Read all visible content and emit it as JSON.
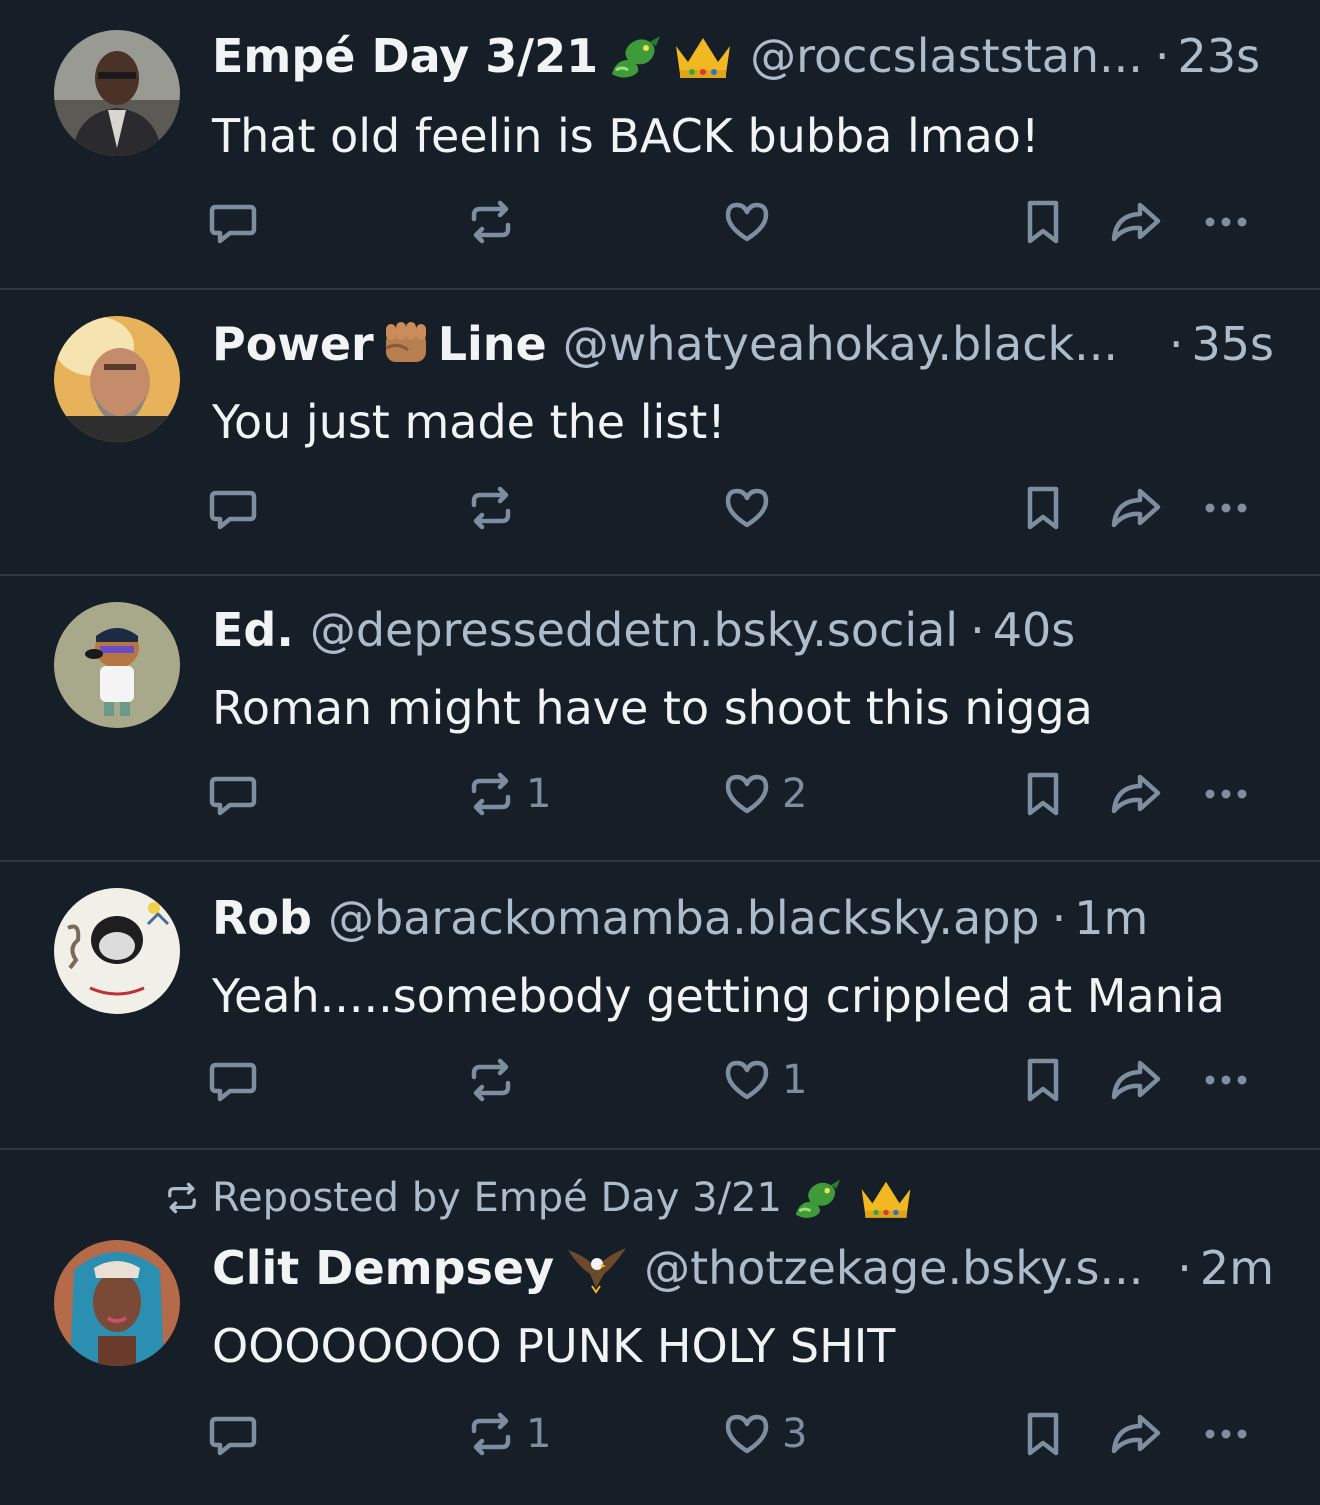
{
  "feed": {
    "posts": [
      {
        "name": "Empé Day 3/21",
        "emoji": [
          "dragon-emoji",
          "crown-emoji"
        ],
        "handle": "@roccslaststan...",
        "time": "23s",
        "text": "That old feelin is BACK bubba lmao!",
        "reply_count": "",
        "repost_count": "",
        "like_count": ""
      },
      {
        "name": "Power",
        "name_suffix": "Line",
        "emoji": [
          "raised-fist-emoji"
        ],
        "handle": "@whatyeahokay.black...",
        "time": "35s",
        "text": "You just made the list!",
        "reply_count": "",
        "repost_count": "",
        "like_count": ""
      },
      {
        "name": "Ed.",
        "handle": "@depresseddetn.bsky.social",
        "time": "40s",
        "text": "Roman might have to shoot this nigga",
        "reply_count": "",
        "repost_count": "1",
        "like_count": "2"
      },
      {
        "name": "Rob",
        "handle": "@barackomamba.blacksky.app",
        "time": "1m",
        "text": "Yeah.....somebody getting crippled at Mania",
        "reply_count": "",
        "repost_count": "",
        "like_count": "1"
      },
      {
        "reposted_by": "Reposted by Empé Day 3/21",
        "reposted_by_emoji": [
          "dragon-emoji",
          "crown-emoji"
        ],
        "name": "Clit Dempsey",
        "emoji": [
          "eagle-emoji"
        ],
        "handle": "@thotzekage.bsky.s...",
        "time": "2m",
        "text": "OOOOOOOO PUNK HOLY SHIT",
        "reply_count": "",
        "repost_count": "1",
        "like_count": "3"
      }
    ],
    "separator": "·"
  },
  "colors": {
    "background": "#161e27",
    "text": "#f1f3f5",
    "muted": "#aebbc9",
    "icon": "#7f8e9e",
    "divider": "#2e3843"
  }
}
